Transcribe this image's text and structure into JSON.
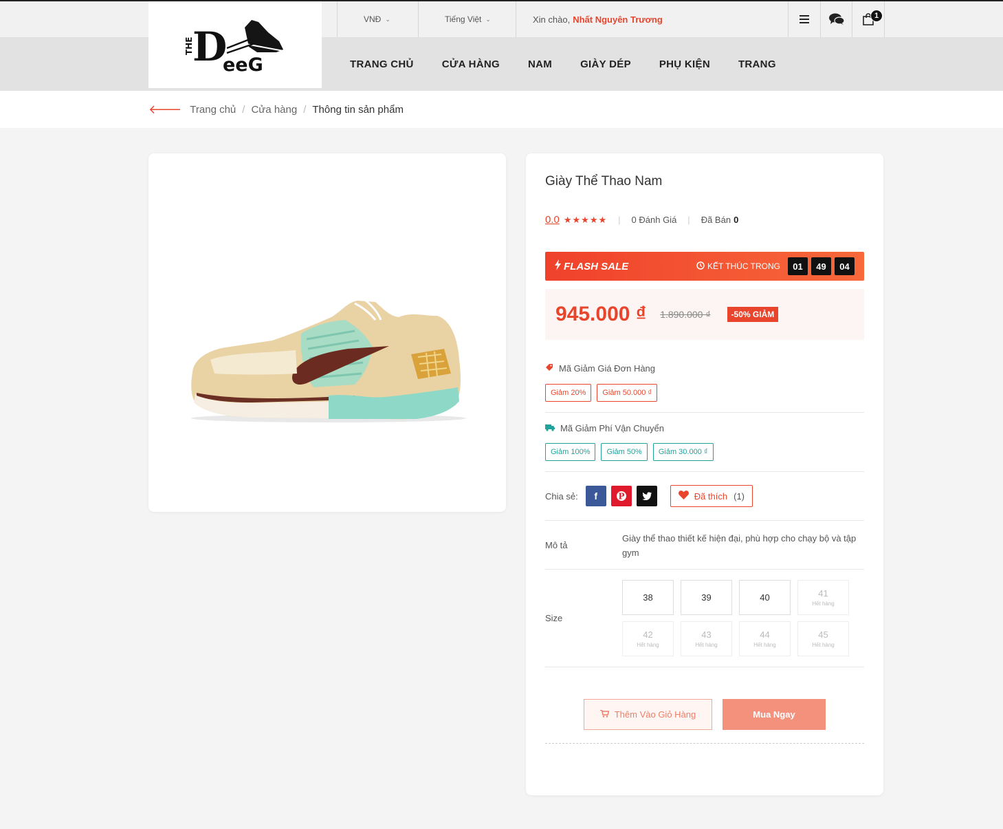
{
  "header": {
    "currency": "VNĐ",
    "language": "Tiếng Việt",
    "greeting": "Xin chào,",
    "user_name": "Nhất Nguyên Trương",
    "cart_count": "1",
    "logo": {
      "the": "THE",
      "d": "D",
      "eeg": "eeG"
    },
    "icons": {
      "menu": "menu-icon",
      "chat": "chat-icon",
      "cart": "shopping-bag-icon"
    }
  },
  "nav": [
    {
      "label": "TRANG CHỦ"
    },
    {
      "label": "CỬA HÀNG"
    },
    {
      "label": "NAM"
    },
    {
      "label": "GIÀY DÉP"
    },
    {
      "label": "PHỤ KIỆN"
    },
    {
      "label": "TRANG"
    }
  ],
  "breadcrumb": {
    "home": "Trang chủ",
    "shop": "Cửa hàng",
    "current": "Thông tin sản phẩm"
  },
  "product": {
    "title": "Giày Thể Thao Nam",
    "rating": "0.0",
    "stars": "★★★★★",
    "reviews": "0 Đánh Giá",
    "sold_label": "Đã Bán",
    "sold_count": "0",
    "flash_label": "FLASH SALE",
    "ends_in": "KẾT THÚC TRONG",
    "timer": {
      "h": "01",
      "m": "49",
      "s": "04"
    },
    "price": "945.000 ₫",
    "old_price": "1.890.000 ₫",
    "discount": "-50% GIẢM",
    "order_voucher_label": "Mã Giảm Giá Đơn Hàng",
    "order_vouchers": [
      "Giảm 20%",
      "Giảm 50.000 ₫"
    ],
    "ship_voucher_label": "Mã Giảm Phí Vận Chuyển",
    "ship_vouchers": [
      "Giảm 100%",
      "Giảm 50%",
      "Giảm 30.000 ₫"
    ],
    "share_label": "Chia sẻ:",
    "share": {
      "facebook": "f",
      "pinterest": "P",
      "twitter": "t"
    },
    "like_label": "Đã thích",
    "like_count": "(1)",
    "desc_label": "Mô tả",
    "description": "Giày thể thao thiết kế hiện đại, phù hợp cho chạy bộ và tập gym",
    "size_label": "Size",
    "sizes": [
      {
        "value": "38",
        "status": ""
      },
      {
        "value": "39",
        "status": ""
      },
      {
        "value": "40",
        "status": ""
      },
      {
        "value": "41",
        "status": "Hết hàng"
      },
      {
        "value": "42",
        "status": "Hết hàng"
      },
      {
        "value": "43",
        "status": "Hết hàng"
      },
      {
        "value": "44",
        "status": "Hết hàng"
      },
      {
        "value": "45",
        "status": "Hết hàng"
      }
    ],
    "add_to_cart": "Thêm Vào Giỏ Hàng",
    "buy_now": "Mua Ngay"
  },
  "colors": {
    "accent": "#e8452c",
    "teal": "#1fa39c",
    "facebook": "#3b5998",
    "pinterest": "#e0192c",
    "twitter": "#111111"
  }
}
